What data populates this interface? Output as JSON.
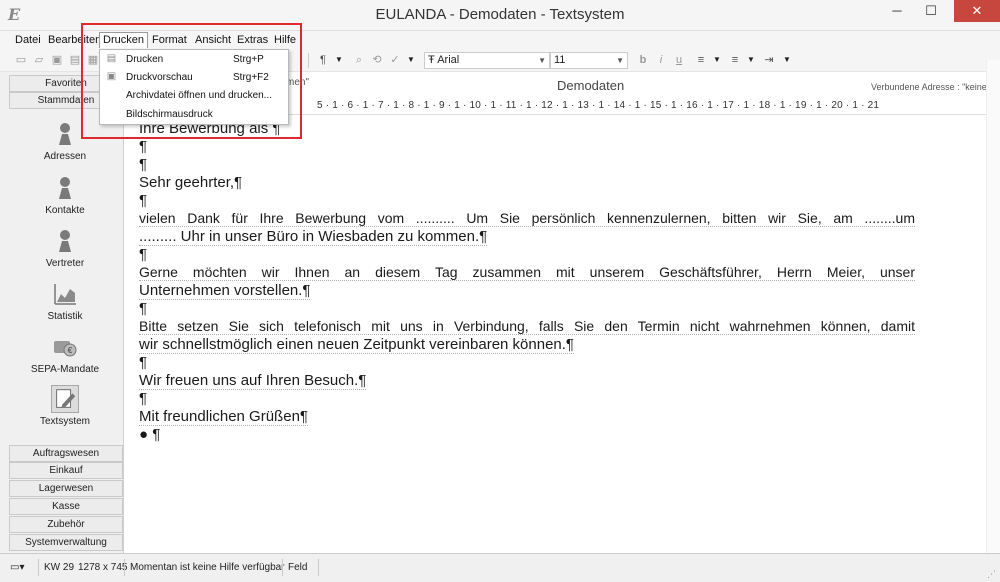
{
  "window": {
    "title": "EULANDA - Demodaten - Textsystem",
    "logo_icon": "eulanda-logo-icon",
    "logo_text": "E"
  },
  "menubar": {
    "items": [
      "Datei",
      "Bearbeiten",
      "Drucken",
      "Format",
      "Ansicht",
      "Extras",
      "Hilfe"
    ],
    "active": "Drucken"
  },
  "drucken_menu": [
    {
      "label": "Drucken",
      "shortcut": "Strg+P",
      "icon": "printer-icon"
    },
    {
      "label": "Druckvorschau",
      "shortcut": "Strg+F2",
      "icon": "print-preview-icon"
    },
    {
      "label": "Archivdatei öffnen und drucken...",
      "shortcut": "",
      "icon": ""
    },
    {
      "label": "Bildschirmausdruck",
      "shortcut": "",
      "icon": ""
    }
  ],
  "toolbar": {
    "font": "Arial",
    "font_size": "11",
    "font_prefix": "Ŧ",
    "pilcrow": "¶"
  },
  "sidebar": {
    "top_tabs": [
      "Favoriten",
      "Stammdaten"
    ],
    "nav": [
      {
        "label": "Adressen",
        "icon": "pawn-icon",
        "selected": false
      },
      {
        "label": "Kontakte",
        "icon": "pawn-icon",
        "selected": false
      },
      {
        "label": "Vertreter",
        "icon": "pawn-icon",
        "selected": false
      },
      {
        "label": "Statistik",
        "icon": "chart-icon",
        "selected": false
      },
      {
        "label": "SEPA-Mandate",
        "icon": "sepa-icon",
        "selected": false
      },
      {
        "label": "Textsystem",
        "icon": "pencil-icon",
        "selected": true
      }
    ],
    "bottom_tabs": [
      "Auftragswesen",
      "Einkauf",
      "Lagerwesen",
      "Kasse",
      "Zubehör",
      "Systemverwaltung"
    ]
  },
  "editor": {
    "header_fragment": "men\"",
    "doc_title": "Demodaten",
    "linked_address": "Verbundene Adresse : \"keine\"",
    "ruler": "5 · 1 · 6 · 1 · 7 · 1 · 8 · 1 · 9 · 1 · 10 · 1 · 11 · 1 · 12 · 1 · 13 · 1 · 14 · 1 · 15 · 1 · 16 · 1 · 17 · 1 · 18 · 1 · 19 · 1 · 20 · 1 · 21"
  },
  "document": {
    "lines": [
      "Ihre Bewerbung als   ¶",
      "¶",
      "¶",
      "Sehr geehrter,¶",
      "¶",
      "vielen Dank für Ihre Bewerbung vom .......... Um Sie persönlich kennenzulernen, bitten wir Sie, am ........um",
      "......... Uhr in unser Büro in Wiesbaden zu kommen.¶",
      "¶",
      "Gerne möchten wir Ihnen an diesem Tag zusammen mit unserem Geschäftsführer, Herrn Meier, unser",
      "Unternehmen vorstellen.¶",
      "¶",
      "Bitte setzen Sie sich telefonisch mit uns in Verbindung, falls Sie den Termin nicht wahrnehmen können, damit",
      "wir schnellstmöglich einen neuen Zeitpunkt vereinbaren können.¶",
      "¶",
      "Wir freuen uns auf Ihren Besuch.¶",
      "¶",
      "Mit freundlichen Grüßen¶",
      "●   ¶"
    ]
  },
  "statusbar": {
    "week": "KW 29",
    "resolution": "1278 x 745",
    "help": "Momentan ist keine Hilfe verfügbar",
    "field": "Feld"
  }
}
